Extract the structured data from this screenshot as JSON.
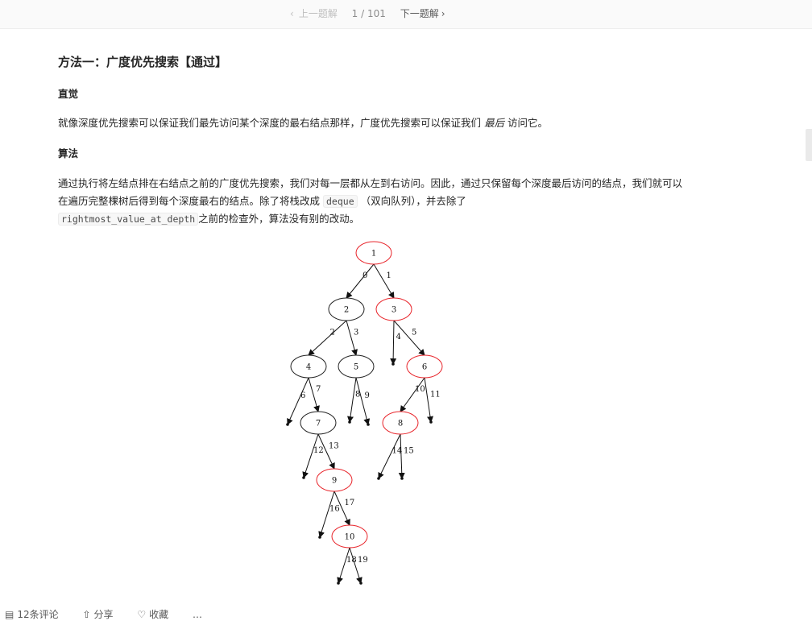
{
  "pager": {
    "prev_label": "上一题解",
    "position": "1 / 101",
    "next_label": "下一题解",
    "prev_icon": "chevron-left-icon",
    "next_icon": "chevron-right-icon"
  },
  "article": {
    "title": "方法一：广度优先搜索【通过】",
    "heading_intuition": "直觉",
    "intuition_text_before": "就像深度优先搜索可以保证我们最先访问某个深度的最右结点那样，广度优先搜索可以保证我们",
    "intuition_emphasis": "最后",
    "intuition_text_after": "访问它。",
    "heading_algorithm": "算法",
    "algo_text_1": "通过执行将左结点排在右结点之前的广度优先搜索，我们对每一层都从左到右访问。因此，通过只保留每个深度最后访问的结点，我们就可以在遍历完整棵树后得到每个深度最右的结点。除了将栈改成",
    "algo_code_1": "deque",
    "algo_text_2": "（双向队列），并去除了",
    "algo_code_2": "rightmost_value_at_depth",
    "algo_text_3": "之前的检查外，算法没有别的改动。"
  },
  "tree": {
    "highlight_color": "#e8242a",
    "normal_color": "#222222",
    "nodes": [
      {
        "id": "1",
        "highlight": true
      },
      {
        "id": "2",
        "highlight": false
      },
      {
        "id": "3",
        "highlight": true
      },
      {
        "id": "4",
        "highlight": false
      },
      {
        "id": "5",
        "highlight": false
      },
      {
        "id": "6",
        "highlight": true
      },
      {
        "id": "7",
        "highlight": false
      },
      {
        "id": "8",
        "highlight": true
      },
      {
        "id": "9",
        "highlight": true
      },
      {
        "id": "10",
        "highlight": true
      }
    ],
    "edges": [
      {
        "from": "1",
        "to": "2",
        "label": "0"
      },
      {
        "from": "1",
        "to": "3",
        "label": "1"
      },
      {
        "from": "2",
        "to": "4",
        "label": "2"
      },
      {
        "from": "2",
        "to": "5",
        "label": "3"
      },
      {
        "from": "3",
        "to": null,
        "label": "4"
      },
      {
        "from": "3",
        "to": "6",
        "label": "5"
      },
      {
        "from": "4",
        "to": null,
        "label": "6"
      },
      {
        "from": "4",
        "to": "7",
        "label": "7"
      },
      {
        "from": "5",
        "to": null,
        "label": "8"
      },
      {
        "from": "5",
        "to": null,
        "label": "9"
      },
      {
        "from": "6",
        "to": "8",
        "label": "10"
      },
      {
        "from": "6",
        "to": null,
        "label": "11"
      },
      {
        "from": "7",
        "to": null,
        "label": "12"
      },
      {
        "from": "7",
        "to": "9",
        "label": "13"
      },
      {
        "from": "8",
        "to": null,
        "label": "14"
      },
      {
        "from": "8",
        "to": null,
        "label": "15"
      },
      {
        "from": "9",
        "to": null,
        "label": "16"
      },
      {
        "from": "9",
        "to": "10",
        "label": "17"
      },
      {
        "from": "10",
        "to": null,
        "label": "18"
      },
      {
        "from": "10",
        "to": null,
        "label": "19"
      }
    ]
  },
  "footer": {
    "comments_label": "12条评论",
    "share_label": "分享",
    "favorite_label": "收藏",
    "more_label": "…",
    "comments_icon": "comment-icon",
    "share_icon": "share-icon",
    "favorite_icon": "heart-icon",
    "more_icon": "more-icon"
  }
}
